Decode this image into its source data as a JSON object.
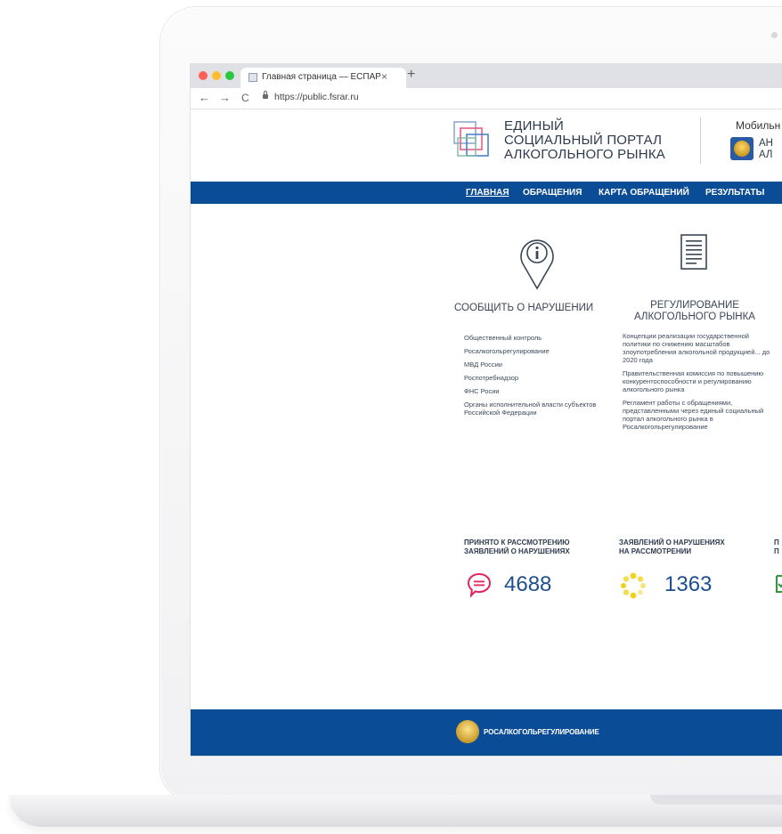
{
  "browser": {
    "tab_title": "Главная страница — ЕСПАР",
    "tab_close": "×",
    "new_tab": "+",
    "back": "←",
    "forward": "→",
    "reload": "C",
    "url": "https://public.fsrar.ru",
    "traffic_lights": [
      "#ff5f57",
      "#ffbd2e",
      "#28c940"
    ]
  },
  "header": {
    "title_lines": [
      "ЕДИНЫЙ",
      "СОЦИАЛЬНЫЙ ПОРТАЛ",
      "АЛКОГОЛЬНОГО РЫНКА"
    ],
    "mobile_label": "Мобильн",
    "mobile_text_lines": [
      "АН",
      "АЛ"
    ]
  },
  "nav": {
    "items": [
      "ГЛАВНАЯ",
      "ОБРАЩЕНИЯ",
      "КАРТА ОБРАЩЕНИЙ",
      "РЕЗУЛЬТАТЫ"
    ],
    "active": "ГЛАВНАЯ"
  },
  "services": {
    "report": {
      "title": "СООБЩИТЬ О НАРУШЕНИИ",
      "links": [
        "Общественный контроль",
        "Росалкогольрегулирование",
        "МВД России",
        "Роспотребнадзор",
        "ФНС Росии",
        "Органы исполнительной власти субъектов Российской Федерации"
      ]
    },
    "regulation": {
      "title_lines": [
        "РЕГУЛИРОВАНИЕ",
        "АЛКОГОЛЬНОГО РЫНКА"
      ],
      "links": [
        "Концепции реализации государственной политики по снижению масштабов злоупотребления алкогольной продукцией... до 2020 года",
        "Правительственная комиссия по повышению конкурентоспособности и регулированию алкогольного рынка",
        "Регламент работы с обращениями, представленными через единый социальный портал алкогольного рынка в Росалкогольрегулирование"
      ]
    }
  },
  "stats": [
    {
      "label_lines": [
        "ПРИНЯТО К РАССМОТРЕНИЮ",
        "ЗАЯВЛЕНИЙ О НАРУШЕНИЯХ"
      ],
      "value": "4688",
      "icon": "speech-bubble-icon",
      "color": "#e2245a"
    },
    {
      "label_lines": [
        "ЗАЯВЛЕНИЙ О НАРУШЕНИЯХ",
        "НА РАССМОТРЕНИИ"
      ],
      "value": "1363",
      "icon": "loading-dots-icon",
      "color": "#f2d11c"
    },
    {
      "label_lines": [
        "П",
        "П"
      ],
      "value": "",
      "icon": "document-check-icon",
      "color": "#2e9a3a"
    }
  ],
  "footer": {
    "text": "РОСАЛКОГОЛЬРЕГУЛИРОВАНИЕ"
  },
  "colors": {
    "brand_blue": "#0b4c97",
    "number_blue": "#1d4f91"
  }
}
